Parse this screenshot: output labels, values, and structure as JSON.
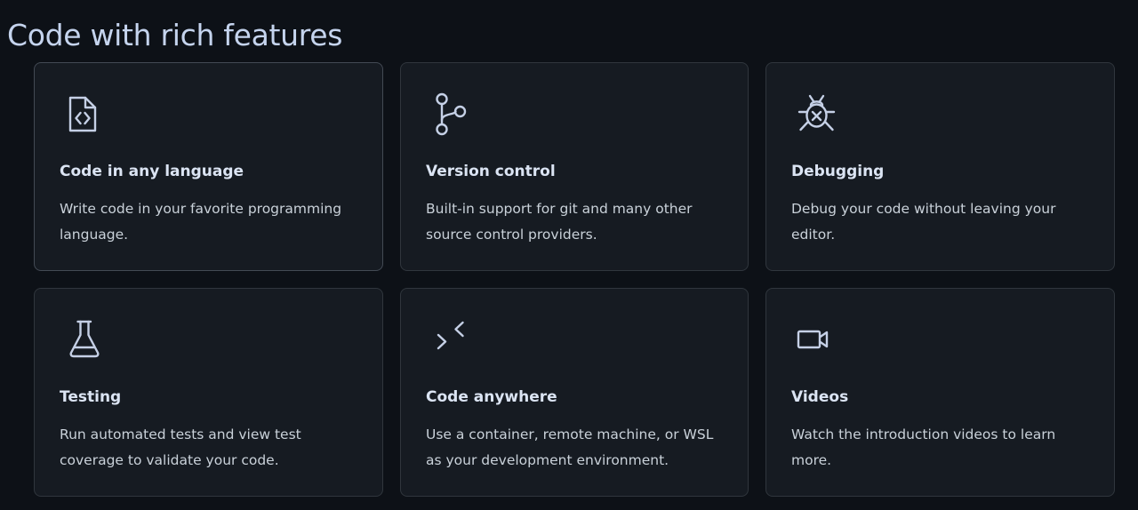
{
  "section": {
    "title": "Code with rich features"
  },
  "colors": {
    "background": "#0d1117",
    "card_background": "#161b22",
    "card_border": "#30363d",
    "icon_stroke": "#c5d0e6",
    "title_text": "#dbe4f3",
    "body_text": "#c9d1d9"
  },
  "cards": [
    {
      "icon": "file-code-icon",
      "title": "Code in any language",
      "description": "Write code in your favorite programming language."
    },
    {
      "icon": "git-branch-icon",
      "title": "Version control",
      "description": "Built-in support for git and many other source control providers."
    },
    {
      "icon": "bug-icon",
      "title": "Debugging",
      "description": "Debug your code without leaving your editor."
    },
    {
      "icon": "beaker-icon",
      "title": "Testing",
      "description": "Run automated tests and view test coverage to validate your code."
    },
    {
      "icon": "remote-icon",
      "title": "Code anywhere",
      "description": "Use a container, remote machine, or WSL as your development environment."
    },
    {
      "icon": "video-icon",
      "title": "Videos",
      "description": "Watch the introduction videos to learn more."
    }
  ]
}
